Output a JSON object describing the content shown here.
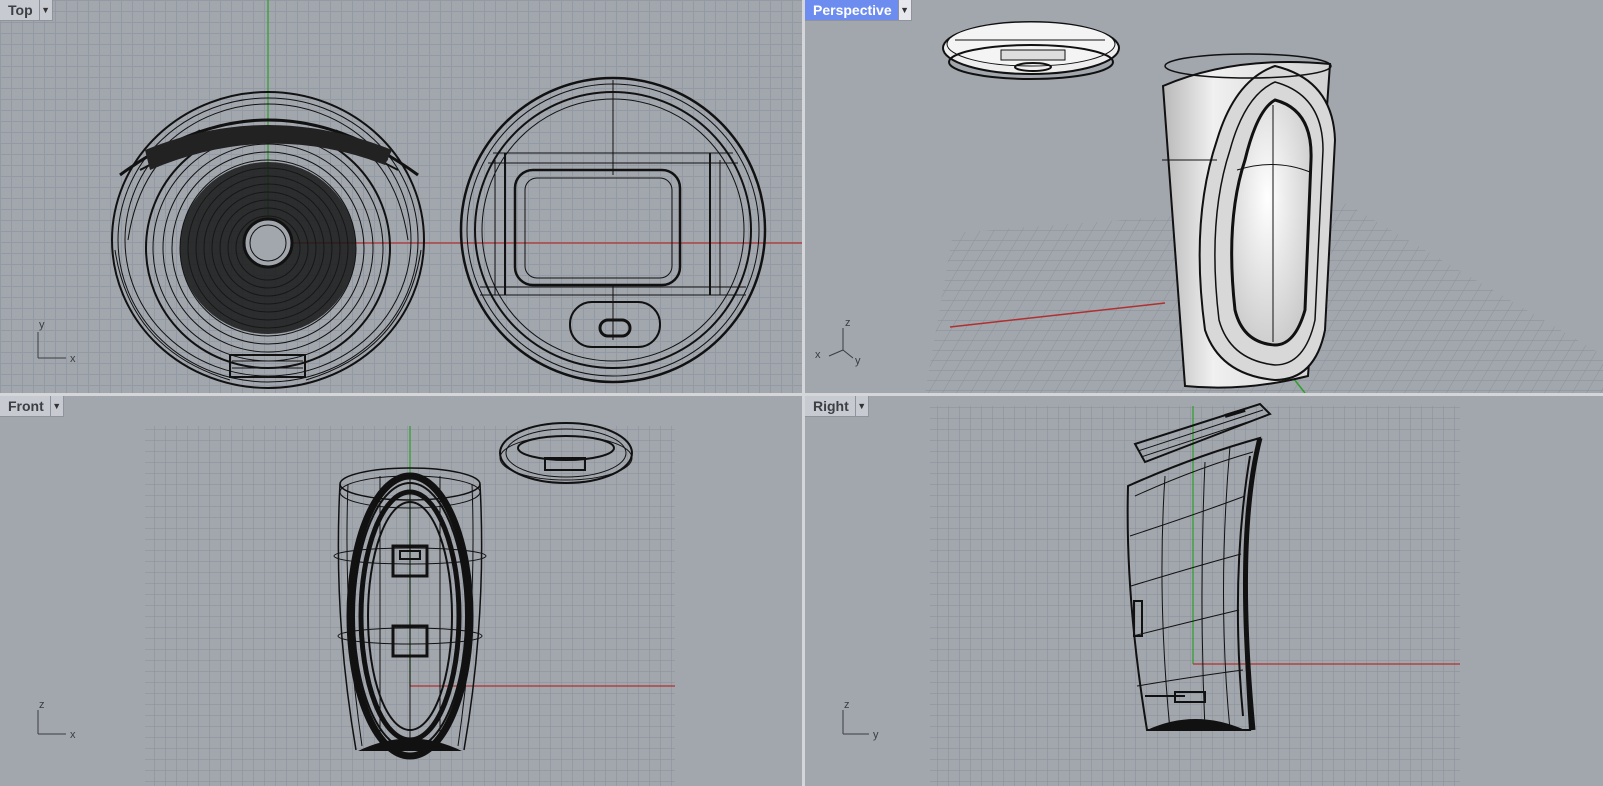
{
  "viewports": {
    "top": {
      "title": "Top",
      "axes": [
        "y",
        "x"
      ]
    },
    "persp": {
      "title": "Perspective",
      "axes": [
        "z",
        "x",
        "y"
      ]
    },
    "front": {
      "title": "Front",
      "axes": [
        "z",
        "x"
      ]
    },
    "right": {
      "title": "Right",
      "axes": [
        "z",
        "y"
      ]
    }
  },
  "colors": {
    "viewport_bg": "#a2a6ad",
    "grid": "#949aa3",
    "x_axis": "#b03030",
    "y_axis": "#2aa02a",
    "active_tab": "#6c8cf0",
    "wire": "#111111",
    "surface": "#ececec"
  },
  "icons": {
    "dropdown": "caret-down-icon"
  }
}
